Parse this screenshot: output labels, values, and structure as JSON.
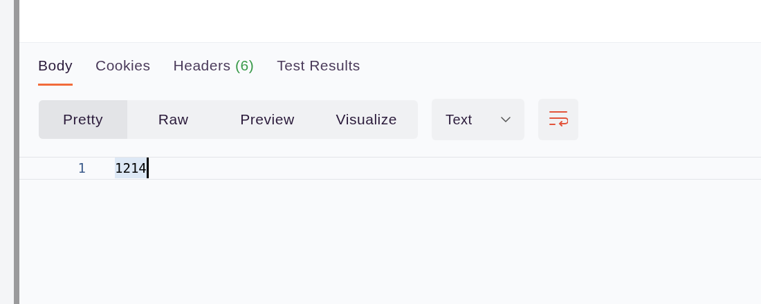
{
  "response_tabs": [
    {
      "label": "Body",
      "selected": true
    },
    {
      "label": "Cookies",
      "selected": false
    },
    {
      "label": "Headers",
      "count": "(6)",
      "selected": false
    },
    {
      "label": "Test Results",
      "selected": false
    }
  ],
  "view_modes": [
    {
      "label": "Pretty",
      "selected": true
    },
    {
      "label": "Raw",
      "selected": false
    },
    {
      "label": "Preview",
      "selected": false
    },
    {
      "label": "Visualize",
      "selected": false
    }
  ],
  "format_select": {
    "value": "Text"
  },
  "wrap_lines": {
    "on": true
  },
  "editor": {
    "lines": [
      {
        "number": "1",
        "text": "1214",
        "selected": true
      }
    ]
  }
}
